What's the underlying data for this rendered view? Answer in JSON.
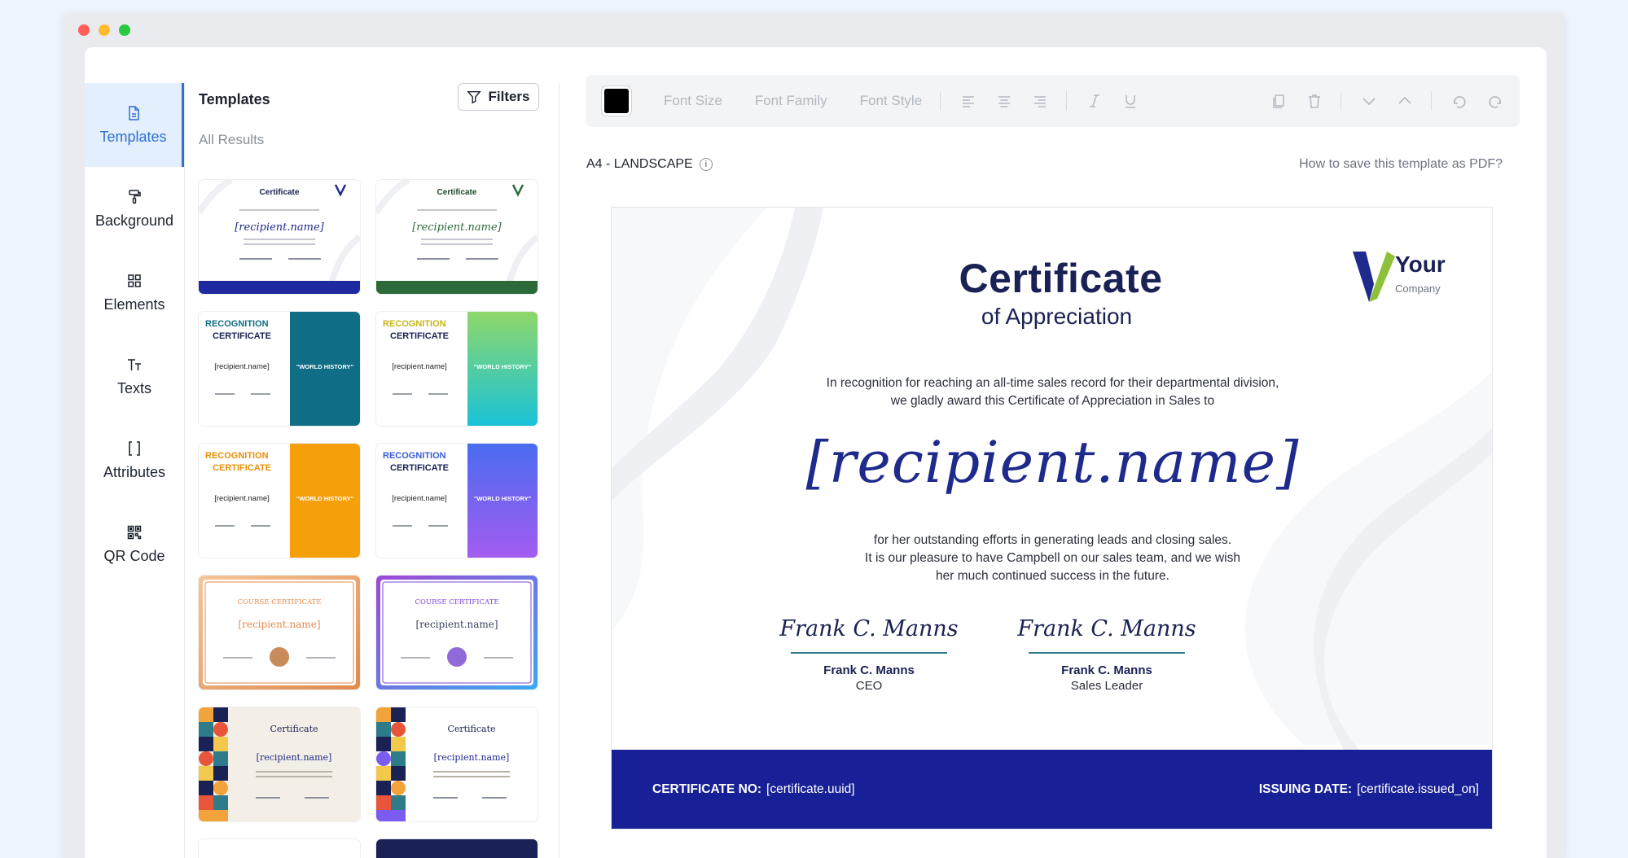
{
  "sidebar": {
    "items": [
      {
        "label": "Templates",
        "icon": "file-icon",
        "active": true
      },
      {
        "label": "Background",
        "icon": "paint-roller-icon"
      },
      {
        "label": "Elements",
        "icon": "grid-icon"
      },
      {
        "label": "Texts",
        "icon": "text-icon"
      },
      {
        "label": "Attributes",
        "icon": "brackets-icon"
      },
      {
        "label": "QR Code",
        "icon": "qr-code-icon"
      }
    ]
  },
  "templates_panel": {
    "title": "Templates",
    "filters_label": "Filters",
    "results_label": "All Results",
    "thumbs": [
      {
        "kind": "appreciation",
        "accent": "#1f2aa0",
        "title": "Certificate",
        "recipient": "[recipient.name]"
      },
      {
        "kind": "appreciation",
        "accent": "#2d6a3a",
        "title": "Certificate",
        "recipient": "[recipient.name]"
      },
      {
        "kind": "recognition",
        "accent": "#0f6d86",
        "title1": "RECOGNITION",
        "title2": "CERTIFICATE",
        "recipient": "[recipient.name]",
        "course": "\"WORLD HISTORY\""
      },
      {
        "kind": "recognition",
        "accent": "#2bc4a8",
        "title1": "RECOGNITION",
        "title2": "CERTIFICATE",
        "recipient": "[recipient.name]",
        "course": "\"WORLD HISTORY\""
      },
      {
        "kind": "recognition",
        "accent": "#f59f0b",
        "title1": "RECOGNITION",
        "title2": "CERTIFICATE",
        "recipient": "[recipient.name]",
        "course": "\"WORLD HISTORY\""
      },
      {
        "kind": "recognition",
        "accent": "#7b5cf0",
        "title1": "RECOGNITION",
        "title2": "CERTIFICATE",
        "recipient": "[recipient.name]",
        "course": "\"WORLD HISTORY\""
      },
      {
        "kind": "course",
        "accent": "#e58a4b",
        "title": "COURSE CERTIFICATE",
        "recipient": "[recipient.name]"
      },
      {
        "kind": "course",
        "accent": "#7b46d6",
        "title": "COURSE CERTIFICATE",
        "recipient": "[recipient.name]"
      },
      {
        "kind": "geometric",
        "accent": "#f4efe6",
        "title": "Certificate",
        "recipient": "[recipient.name]"
      },
      {
        "kind": "geometric",
        "accent": "#ffffff",
        "title": "Certificate",
        "recipient": "[recipient.name]"
      }
    ]
  },
  "toolbar": {
    "color": "#000000",
    "font_size": "Font Size",
    "font_family": "Font Family",
    "font_style": "Font Style"
  },
  "canvas": {
    "page_size": "A4 - LANDSCAPE",
    "help_link": "How to save this template as PDF?"
  },
  "certificate": {
    "heading": "Certificate",
    "subheading": "of Appreciation",
    "intro_line1": "In recognition for reaching an all-time sales record for their departmental division,",
    "intro_line2": "we gladly award this Certificate of Appreciation in Sales to",
    "recipient": "[recipient.name]",
    "body_line1": "for her outstanding efforts in generating leads and closing sales.",
    "body_line2": "It is our pleasure to have Campbell on our sales team, and we wish",
    "body_line3": "her much continued success in the future.",
    "signatures": [
      {
        "script": "Frank C. Manns",
        "name": "Frank C. Manns",
        "role": "CEO"
      },
      {
        "script": "Frank C. Manns",
        "name": "Frank C. Manns",
        "role": "Sales Leader"
      }
    ],
    "logo_your": "Your",
    "logo_company": "Company",
    "footer_no_label": "CERTIFICATE NO:",
    "footer_no_value": "[certificate.uuid]",
    "footer_date_label": "ISSUING DATE:",
    "footer_date_value": "[certificate.issued_on]",
    "brand_color": "#172096"
  }
}
